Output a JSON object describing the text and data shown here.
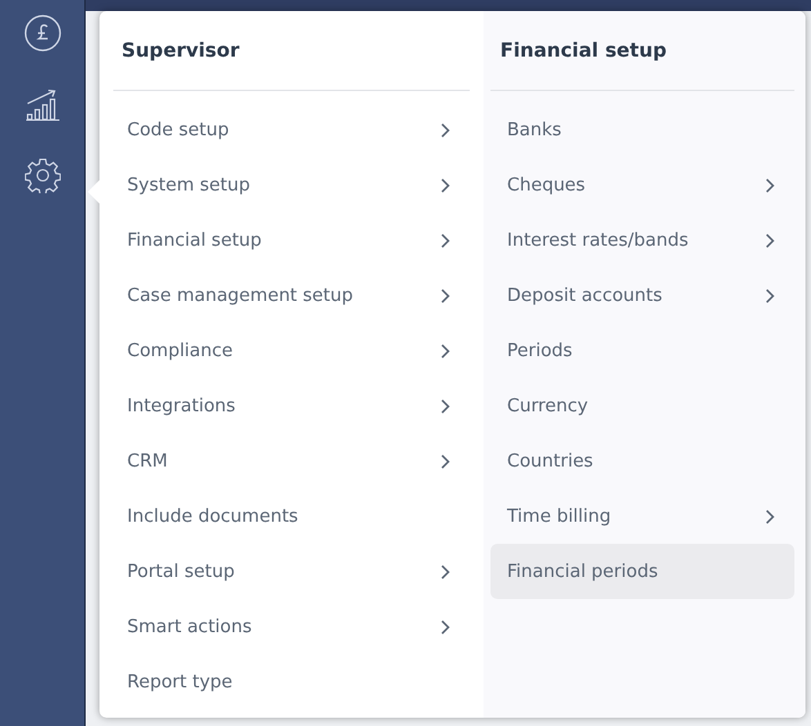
{
  "menu": {
    "columns": [
      {
        "title": "Supervisor",
        "items": [
          {
            "label": "Code setup",
            "submenu": true,
            "selected": false
          },
          {
            "label": "System setup",
            "submenu": true,
            "selected": false
          },
          {
            "label": "Financial setup",
            "submenu": true,
            "selected": false
          },
          {
            "label": "Case management setup",
            "submenu": true,
            "selected": false
          },
          {
            "label": "Compliance",
            "submenu": true,
            "selected": false
          },
          {
            "label": "Integrations",
            "submenu": true,
            "selected": false
          },
          {
            "label": "CRM",
            "submenu": true,
            "selected": false
          },
          {
            "label": "Include documents",
            "submenu": false,
            "selected": false
          },
          {
            "label": "Portal setup",
            "submenu": true,
            "selected": false
          },
          {
            "label": "Smart actions",
            "submenu": true,
            "selected": false
          },
          {
            "label": "Report type",
            "submenu": false,
            "selected": false
          }
        ]
      },
      {
        "title": "Financial setup",
        "items": [
          {
            "label": "Banks",
            "submenu": false,
            "selected": false
          },
          {
            "label": "Cheques",
            "submenu": true,
            "selected": false
          },
          {
            "label": "Interest rates/bands",
            "submenu": true,
            "selected": false
          },
          {
            "label": "Deposit accounts",
            "submenu": true,
            "selected": false
          },
          {
            "label": "Periods",
            "submenu": false,
            "selected": false
          },
          {
            "label": "Currency",
            "submenu": false,
            "selected": false
          },
          {
            "label": "Countries",
            "submenu": false,
            "selected": false
          },
          {
            "label": "Time billing",
            "submenu": true,
            "selected": false
          },
          {
            "label": "Financial periods",
            "submenu": false,
            "selected": true
          }
        ]
      }
    ]
  }
}
